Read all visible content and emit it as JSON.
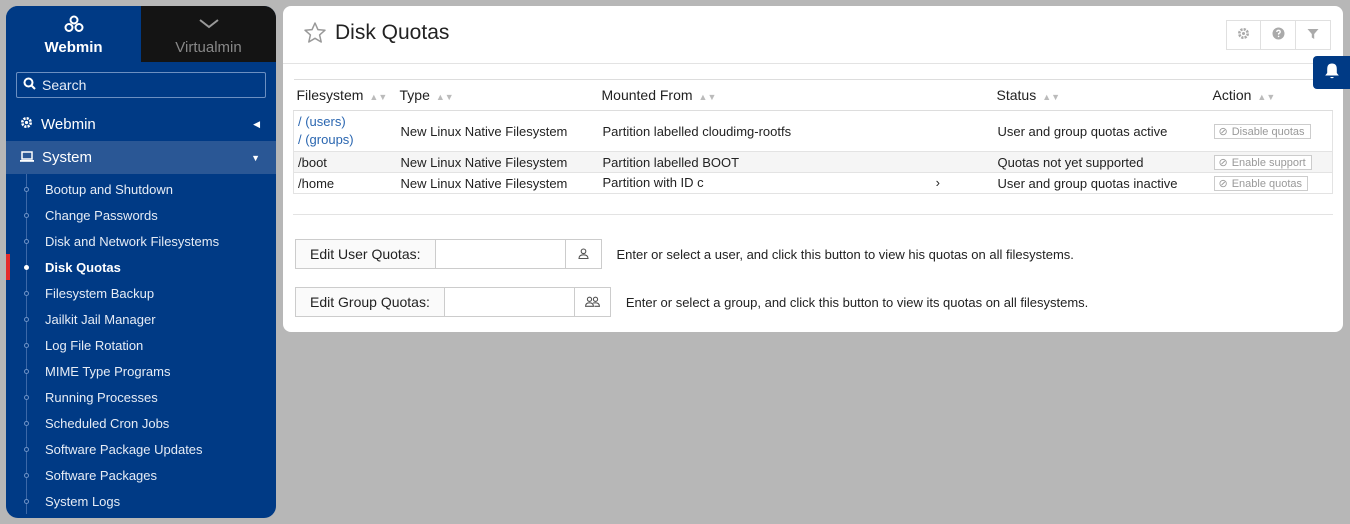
{
  "sidebar": {
    "tabs": [
      {
        "label": "Webmin",
        "icon": "webmin-logo-icon"
      },
      {
        "label": "Virtualmin",
        "icon": "chevron-down-icon"
      }
    ],
    "search_placeholder": "Search",
    "sections": [
      {
        "label": "Webmin",
        "icon": "gear-icon"
      },
      {
        "label": "System",
        "icon": "laptop-icon"
      }
    ],
    "items": [
      "Bootup and Shutdown",
      "Change Passwords",
      "Disk and Network Filesystems",
      "Disk Quotas",
      "Filesystem Backup",
      "Jailkit Jail Manager",
      "Log File Rotation",
      "MIME Type Programs",
      "Running Processes",
      "Scheduled Cron Jobs",
      "Software Package Updates",
      "Software Packages",
      "System Logs"
    ],
    "active_item": "Disk Quotas"
  },
  "page": {
    "title": "Disk Quotas"
  },
  "table": {
    "headers": [
      "Filesystem",
      "Type",
      "Mounted From",
      "Status",
      "Action"
    ],
    "rows": [
      {
        "fs_users": "/ (users)",
        "fs_groups": "/ (groups)",
        "type": "New Linux Native Filesystem",
        "mounted": "Partition labelled cloudimg-rootfs",
        "status": "User and group quotas active",
        "action": "Disable quotas"
      },
      {
        "fs": "/boot",
        "type": "New Linux Native Filesystem",
        "mounted": "Partition labelled BOOT",
        "status": "Quotas not yet supported",
        "action": "Enable support"
      },
      {
        "fs": "/home",
        "type": "New Linux Native Filesystem",
        "mounted_prefix": "Partition with ID c",
        "mounted_suffix": "›",
        "status": "User and group quotas inactive",
        "action": "Enable quotas"
      }
    ]
  },
  "user_quota": {
    "button": "Edit User Quotas:",
    "value": "",
    "description": "Enter or select a user, and click this button to view his quotas on all filesystems."
  },
  "group_quota": {
    "button": "Edit Group Quotas:",
    "value": "",
    "description": "Enter or select a group, and click this button to view its quotas on all filesystems."
  }
}
